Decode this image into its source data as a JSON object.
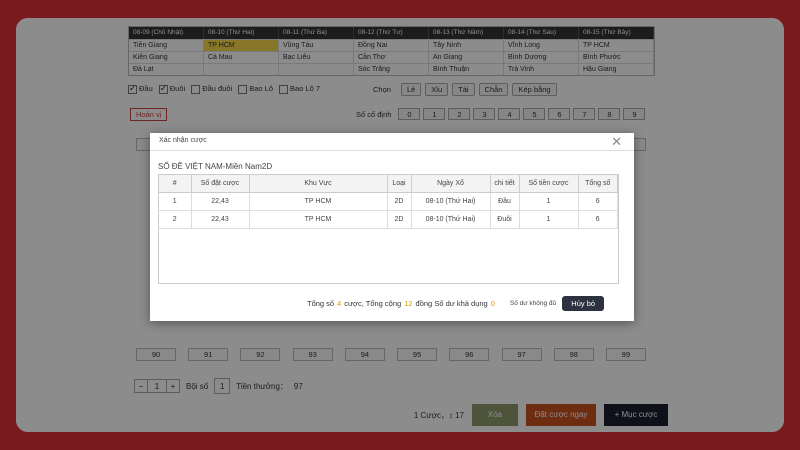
{
  "dates": [
    "08-09 (Chủ Nhật)",
    "08-10 (Thứ Hai)",
    "08-11 (Thứ Ba)",
    "08-12 (Thứ Tư)",
    "08-13 (Thứ Năm)",
    "08-14 (Thứ Sáu)",
    "08-15 (Thứ Bảy)"
  ],
  "provinces": [
    [
      "Tiền Giang",
      "TP HCM",
      "Vũng Tàu",
      "Đồng Nai",
      "Tây Ninh",
      "Vĩnh Long",
      "TP HCM"
    ],
    [
      "Kiên Giang",
      "Cà Mau",
      "Bạc Liêu",
      "Cần Thơ",
      "An Giang",
      "Bình Dương",
      "Bình Phước"
    ],
    [
      "Đà Lạt",
      "",
      "",
      "Sóc Trăng",
      "Bình Thuận",
      "Trà Vinh",
      "Hậu Giang"
    ]
  ],
  "options": {
    "dau": "Đầu",
    "duoi": "Đuôi",
    "dau_duoi": "Đầu đuôi",
    "bao_lo": "Bao Lô",
    "bao_lo_7": "Bao Lô 7",
    "chon_label": "Chọn",
    "buttons": [
      "Lẻ",
      "Xỉu",
      "Tài",
      "Chẵn",
      "Kép bằng"
    ]
  },
  "hoan_vi": "Hoán vị",
  "so_co_dinh": {
    "label": "Số cố định",
    "values": [
      "0",
      "1",
      "2",
      "3",
      "4",
      "5",
      "6",
      "7",
      "8",
      "9"
    ]
  },
  "number_rows": [
    [
      "90",
      "91",
      "92",
      "93",
      "94",
      "95",
      "96",
      "97",
      "98",
      "99"
    ]
  ],
  "bottom": {
    "minus": "−",
    "step_value": "1",
    "plus": "+",
    "boi_so_label": "Bội số",
    "boi_so_value": "1",
    "tien_thuong_label": "Tiền thưởng：",
    "tien_thuong_value": "97"
  },
  "actions": {
    "summary": "1 Cược，↕ 17",
    "xoa": "Xóa",
    "dat_cuoc": "Đặt cược ngay",
    "muc_cuoc": "+ Mục cược"
  },
  "modal": {
    "title": "Xác nhận cược",
    "subtitle": "SỐ ĐỀ VIỆT NAM-Miền Nam2D",
    "columns": [
      "#",
      "Số đặt cược",
      "Khu Vực",
      "Loại",
      "Ngày Xổ",
      "chi tiết",
      "Số tiền cược",
      "Tổng số"
    ],
    "rows": [
      [
        "1",
        "22,43",
        "TP HCM",
        "2D",
        "08-10 (Thứ Hai)",
        "Đầu",
        "1",
        "6"
      ],
      [
        "2",
        "22,43",
        "TP HCM",
        "2D",
        "08-10 (Thứ Hai)",
        "Đuôi",
        "1",
        "6"
      ]
    ],
    "footer": {
      "tong_so": "Tổng số",
      "bet_count": "4",
      "cuoc_tong_cong": "cược, Tổng cộng",
      "total": "12",
      "dong_so_du": "đồng Số dư khả dụng",
      "balance": "0",
      "insufficient": "Số dư không đủ",
      "cancel": "Hủy bỏ"
    }
  }
}
